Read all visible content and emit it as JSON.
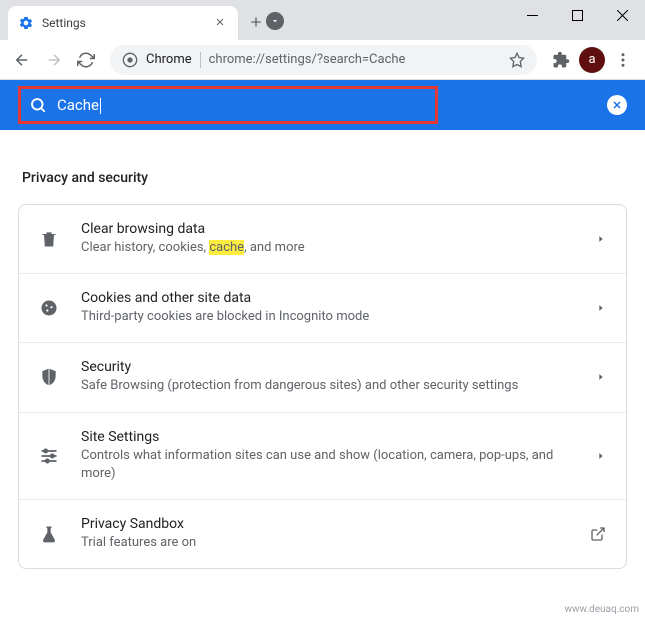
{
  "window": {
    "tab_title": "Settings",
    "chevron_icon": "chevron-down",
    "controls": {
      "min": "–",
      "max": "▢",
      "close": "✕"
    }
  },
  "toolbar": {
    "omnibox_origin": "Chrome",
    "omnibox_url": "chrome://settings/?search=Cache",
    "avatar_letter": "a"
  },
  "search": {
    "query": "Cache"
  },
  "section": {
    "title": "Privacy and security",
    "items": [
      {
        "icon": "trash",
        "title": "Clear browsing data",
        "sub_pre": "Clear history, cookies, ",
        "sub_hl": "cache",
        "sub_post": ", and more",
        "action": "chevron"
      },
      {
        "icon": "cookie",
        "title": "Cookies and other site data",
        "sub": "Third-party cookies are blocked in Incognito mode",
        "action": "chevron"
      },
      {
        "icon": "shield",
        "title": "Security",
        "sub": "Safe Browsing (protection from dangerous sites) and other security settings",
        "action": "chevron"
      },
      {
        "icon": "tune",
        "title": "Site Settings",
        "sub": "Controls what information sites can use and show (location, camera, pop-ups, and more)",
        "action": "chevron"
      },
      {
        "icon": "flask",
        "title": "Privacy Sandbox",
        "sub": "Trial features are on",
        "action": "external"
      }
    ]
  },
  "watermark": "www.deuaq.com"
}
